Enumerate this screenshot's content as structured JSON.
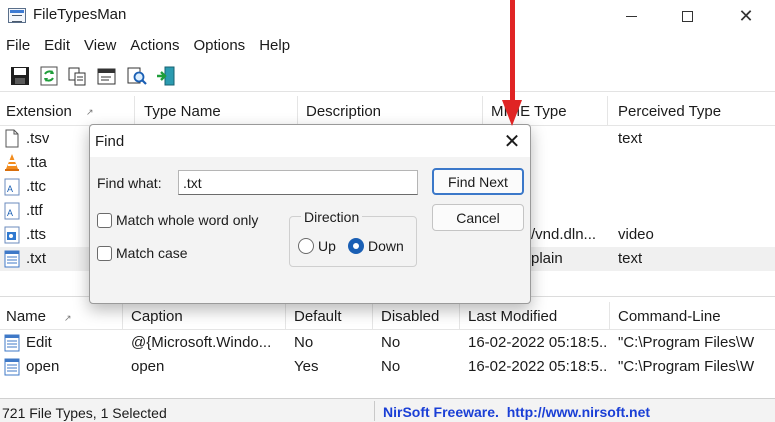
{
  "window": {
    "title": "FileTypesMan"
  },
  "menu": [
    "File",
    "Edit",
    "View",
    "Actions",
    "Options",
    "Help"
  ],
  "toolbar": {
    "icons": [
      "save-icon",
      "refresh-icon",
      "copy-icon",
      "properties-icon",
      "find-icon",
      "exit-icon"
    ]
  },
  "file_types": {
    "columns": [
      "Extension",
      "Type Name",
      "Description",
      "MIME Type",
      "Perceived Type"
    ],
    "rows": [
      {
        "ext": ".tsv",
        "mime": "",
        "perceived": "text",
        "icon": "document-icon"
      },
      {
        "ext": ".tta",
        "mime": "",
        "perceived": "",
        "icon": "vlc-cone-icon"
      },
      {
        "ext": ".ttc",
        "mime": "",
        "perceived": "",
        "icon": "font-file-icon"
      },
      {
        "ext": ".ttf",
        "mime": "",
        "perceived": "",
        "icon": "font-file-icon"
      },
      {
        "ext": ".tts",
        "mime": "/vnd.dln...",
        "perceived": "video",
        "icon": "media-file-icon"
      },
      {
        "ext": ".txt",
        "mime": "plain",
        "perceived": "text",
        "icon": "notepad-icon",
        "selected": true
      }
    ]
  },
  "actions": {
    "columns": [
      "Name",
      "Caption",
      "Default",
      "Disabled",
      "Last Modified",
      "Command-Line"
    ],
    "rows": [
      {
        "name": "Edit",
        "caption": "@{Microsoft.Windo...",
        "default": "No",
        "disabled": "No",
        "modified": "16-02-2022 05:18:5...",
        "command": "\"C:\\Program Files\\W"
      },
      {
        "name": "open",
        "caption": "open",
        "default": "Yes",
        "disabled": "No",
        "modified": "16-02-2022 05:18:5...",
        "command": "\"C:\\Program Files\\W"
      }
    ]
  },
  "status": {
    "left": "721 File Types, 1 Selected",
    "right": "NirSoft Freeware.  http://www.nirsoft.net"
  },
  "find_dialog": {
    "title": "Find",
    "find_what_label": "Find what:",
    "find_what_value": ".txt",
    "find_next_label": "Find Next",
    "cancel_label": "Cancel",
    "match_whole_word_label": "Match whole word only",
    "match_whole_word_checked": false,
    "match_case_label": "Match case",
    "match_case_checked": false,
    "direction_label": "Direction",
    "direction_up_label": "Up",
    "direction_down_label": "Down",
    "direction_selected": "Down"
  },
  "colors": {
    "annotation_arrow": "#e02424",
    "status_link": "#1a3fd6",
    "selected_row": "#f0f0f0",
    "primary_button_border": "#3b78c9"
  }
}
